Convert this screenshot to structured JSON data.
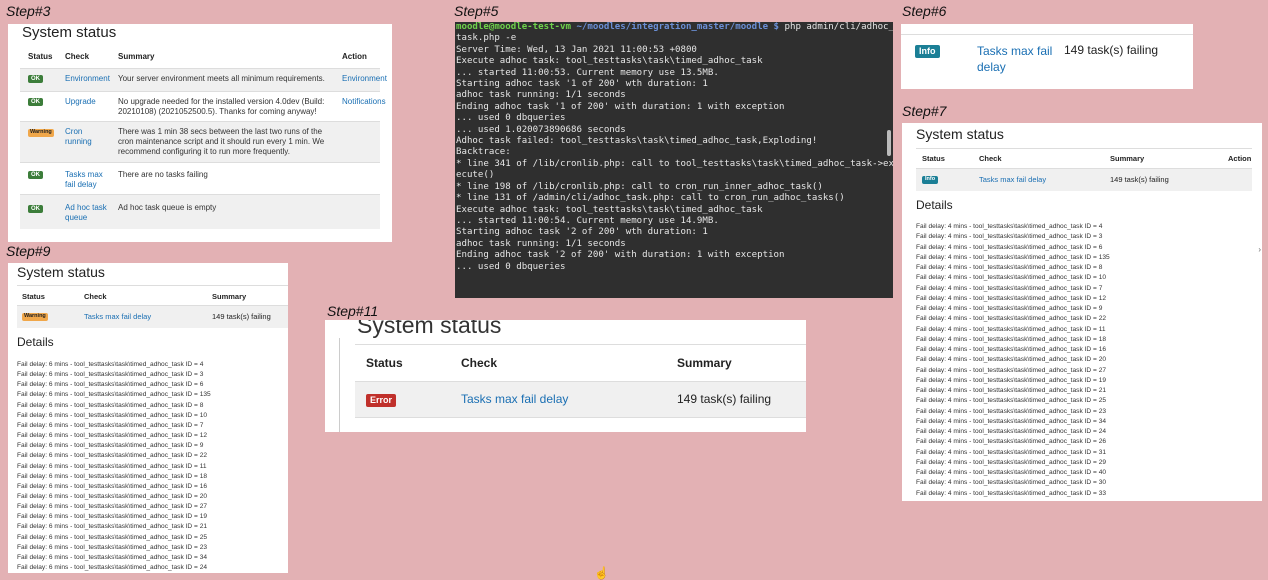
{
  "steps": {
    "step3": "Step#3",
    "step5": "Step#5",
    "step6": "Step#6",
    "step7": "Step#7",
    "step9": "Step#9",
    "step11": "Step#11"
  },
  "colors": {
    "background": "#e3b1b4",
    "link": "#1a6fb3",
    "ok": "#3c7d3a",
    "warning": "#f0a74a",
    "info": "#1b7f96",
    "error": "#c0302b",
    "terminal_bg": "#2f2f2f"
  },
  "step3_panel": {
    "title": "System status",
    "headers": {
      "status": "Status",
      "check": "Check",
      "summary": "Summary",
      "action": "Action"
    },
    "rows": [
      {
        "status": "OK",
        "check": "Environment",
        "summary": "Your server environment meets all minimum requirements.",
        "action": "Environment"
      },
      {
        "status": "OK",
        "check": "Upgrade",
        "summary": "No upgrade needed for the installed version 4.0dev (Build: 20210108) (2021052500.5). Thanks for coming anyway!",
        "action": "Notifications"
      },
      {
        "status": "Warning",
        "check": "Cron running",
        "summary": "There was 1 min 38 secs between the last two runs of the cron maintenance script and it should run every 1 min. We recommend configuring it to run more frequently.",
        "action": ""
      },
      {
        "status": "OK",
        "check": "Tasks max fail delay",
        "summary": "There are no tasks failing",
        "action": ""
      },
      {
        "status": "OK",
        "check": "Ad hoc task queue",
        "summary": "Ad hoc task queue is empty",
        "action": ""
      }
    ]
  },
  "terminal": {
    "prompt_user": "moodle@moodle-test-vm",
    "prompt_path": " ~/moodles/integration_master/moodle $",
    "command": " php admin/cli/adhoc_",
    "lines": [
      "task.php -e",
      "Server Time: Wed, 13 Jan 2021 11:00:53 +0800",
      "",
      "Execute adhoc task: tool_testtasks\\task\\timed_adhoc_task",
      "... started 11:00:53. Current memory use 13.5MB.",
      "Starting adhoc task '1 of 200' wth duration: 1",
      "adhoc task running: 1/1 seconds",
      "Ending adhoc task '1 of 200' with duration: 1 with exception",
      "... used 0 dbqueries",
      "... used 1.020073890686 seconds",
      "Adhoc task failed: tool_testtasks\\task\\timed_adhoc_task,Exploding!",
      "Backtrace:",
      "* line 341 of /lib/cronlib.php: call to tool_testtasks\\task\\timed_adhoc_task->ex",
      "ecute()",
      "* line 198 of /lib/cronlib.php: call to cron_run_inner_adhoc_task()",
      "* line 131 of /admin/cli/adhoc_task.php: call to cron_run_adhoc_tasks()",
      "",
      "Execute adhoc task: tool_testtasks\\task\\timed_adhoc_task",
      "... started 11:00:54. Current memory use 14.9MB.",
      "Starting adhoc task '2 of 200' wth duration: 1",
      "adhoc task running: 1/1 seconds",
      "Ending adhoc task '2 of 200' with duration: 1 with exception",
      "... used 0 dbqueries"
    ]
  },
  "step6_panel": {
    "status": "Info",
    "check": "Tasks max fail delay",
    "summary": "149 task(s) failing"
  },
  "step7_panel": {
    "title": "System status",
    "headers": {
      "status": "Status",
      "check": "Check",
      "summary": "Summary",
      "action": "Action"
    },
    "row": {
      "status": "Info",
      "check": "Tasks max fail delay",
      "summary": "149 task(s) failing"
    },
    "details_title": "Details",
    "details": [
      "Fail delay: 4 mins - tool_testtasks\\task\\timed_adhoc_task ID = 4",
      "Fail delay: 4 mins - tool_testtasks\\task\\timed_adhoc_task ID = 3",
      "Fail delay: 4 mins - tool_testtasks\\task\\timed_adhoc_task ID = 6",
      "Fail delay: 4 mins - tool_testtasks\\task\\timed_adhoc_task ID = 135",
      "Fail delay: 4 mins - tool_testtasks\\task\\timed_adhoc_task ID = 8",
      "Fail delay: 4 mins - tool_testtasks\\task\\timed_adhoc_task ID = 10",
      "Fail delay: 4 mins - tool_testtasks\\task\\timed_adhoc_task ID = 7",
      "Fail delay: 4 mins - tool_testtasks\\task\\timed_adhoc_task ID = 12",
      "Fail delay: 4 mins - tool_testtasks\\task\\timed_adhoc_task ID = 9",
      "Fail delay: 4 mins - tool_testtasks\\task\\timed_adhoc_task ID = 22",
      "Fail delay: 4 mins - tool_testtasks\\task\\timed_adhoc_task ID = 11",
      "Fail delay: 4 mins - tool_testtasks\\task\\timed_adhoc_task ID = 18",
      "Fail delay: 4 mins - tool_testtasks\\task\\timed_adhoc_task ID = 16",
      "Fail delay: 4 mins - tool_testtasks\\task\\timed_adhoc_task ID = 20",
      "Fail delay: 4 mins - tool_testtasks\\task\\timed_adhoc_task ID = 27",
      "Fail delay: 4 mins - tool_testtasks\\task\\timed_adhoc_task ID = 19",
      "Fail delay: 4 mins - tool_testtasks\\task\\timed_adhoc_task ID = 21",
      "Fail delay: 4 mins - tool_testtasks\\task\\timed_adhoc_task ID = 25",
      "Fail delay: 4 mins - tool_testtasks\\task\\timed_adhoc_task ID = 23",
      "Fail delay: 4 mins - tool_testtasks\\task\\timed_adhoc_task ID = 34",
      "Fail delay: 4 mins - tool_testtasks\\task\\timed_adhoc_task ID = 24",
      "Fail delay: 4 mins - tool_testtasks\\task\\timed_adhoc_task ID = 26",
      "Fail delay: 4 mins - tool_testtasks\\task\\timed_adhoc_task ID = 31",
      "Fail delay: 4 mins - tool_testtasks\\task\\timed_adhoc_task ID = 29",
      "Fail delay: 4 mins - tool_testtasks\\task\\timed_adhoc_task ID = 40",
      "Fail delay: 4 mins - tool_testtasks\\task\\timed_adhoc_task ID = 30",
      "Fail delay: 4 mins - tool_testtasks\\task\\timed_adhoc_task ID = 33"
    ]
  },
  "step9_panel": {
    "title": "System status",
    "headers": {
      "status": "Status",
      "check": "Check",
      "summary": "Summary"
    },
    "row": {
      "status": "Warning",
      "check": "Tasks max fail delay",
      "summary": "149 task(s) failing"
    },
    "details_title": "Details",
    "details": [
      "Fail delay: 6 mins - tool_testtasks\\task\\timed_adhoc_task ID = 4",
      "Fail delay: 6 mins - tool_testtasks\\task\\timed_adhoc_task ID = 3",
      "Fail delay: 6 mins - tool_testtasks\\task\\timed_adhoc_task ID = 6",
      "Fail delay: 6 mins - tool_testtasks\\task\\timed_adhoc_task ID = 135",
      "Fail delay: 6 mins - tool_testtasks\\task\\timed_adhoc_task ID = 8",
      "Fail delay: 6 mins - tool_testtasks\\task\\timed_adhoc_task ID = 10",
      "Fail delay: 6 mins - tool_testtasks\\task\\timed_adhoc_task ID = 7",
      "Fail delay: 6 mins - tool_testtasks\\task\\timed_adhoc_task ID = 12",
      "Fail delay: 6 mins - tool_testtasks\\task\\timed_adhoc_task ID = 9",
      "Fail delay: 6 mins - tool_testtasks\\task\\timed_adhoc_task ID = 22",
      "Fail delay: 6 mins - tool_testtasks\\task\\timed_adhoc_task ID = 11",
      "Fail delay: 6 mins - tool_testtasks\\task\\timed_adhoc_task ID = 18",
      "Fail delay: 6 mins - tool_testtasks\\task\\timed_adhoc_task ID = 16",
      "Fail delay: 6 mins - tool_testtasks\\task\\timed_adhoc_task ID = 20",
      "Fail delay: 6 mins - tool_testtasks\\task\\timed_adhoc_task ID = 27",
      "Fail delay: 6 mins - tool_testtasks\\task\\timed_adhoc_task ID = 19",
      "Fail delay: 6 mins - tool_testtasks\\task\\timed_adhoc_task ID = 21",
      "Fail delay: 6 mins - tool_testtasks\\task\\timed_adhoc_task ID = 25",
      "Fail delay: 6 mins - tool_testtasks\\task\\timed_adhoc_task ID = 23",
      "Fail delay: 6 mins - tool_testtasks\\task\\timed_adhoc_task ID = 34",
      "Fail delay: 6 mins - tool_testtasks\\task\\timed_adhoc_task ID = 24"
    ]
  },
  "step11_panel": {
    "title": "System status",
    "headers": {
      "status": "Status",
      "check": "Check",
      "summary": "Summary"
    },
    "row": {
      "status": "Error",
      "check": "Tasks max fail delay",
      "summary": "149 task(s) failing"
    }
  }
}
